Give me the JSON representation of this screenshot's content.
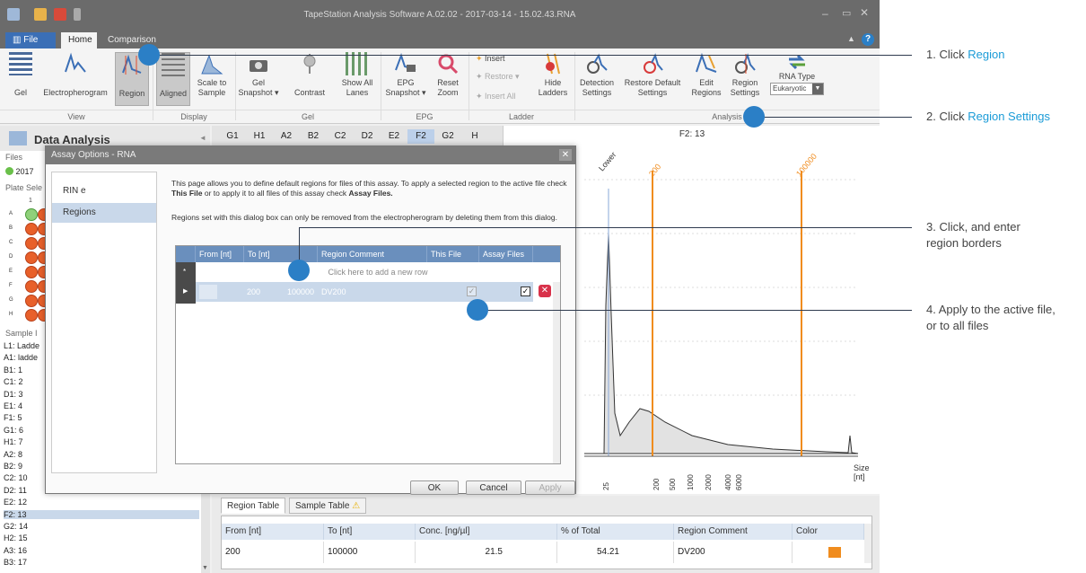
{
  "window": {
    "title": "TapeStation Analysis Software A.02.02 - 2017-03-14 - 15.02.43.RNA"
  },
  "tabs": {
    "file": "File",
    "home": "Home",
    "comparison": "Comparison"
  },
  "ribbon": {
    "gel": "Gel",
    "electropherogram": "Electropherogram",
    "region": "Region",
    "aligned": "Aligned",
    "scale_to_sample_1": "Scale to",
    "scale_to_sample_2": "Sample",
    "gel_snapshot_1": "Gel",
    "gel_snapshot_2": "Snapshot ▾",
    "contrast": "Contrast",
    "show_all_lanes_1": "Show All",
    "show_all_lanes_2": "Lanes",
    "epg_snapshot_1": "EPG",
    "epg_snapshot_2": "Snapshot ▾",
    "reset_zoom_1": "Reset",
    "reset_zoom_2": "Zoom",
    "insert": "Insert",
    "restore": "Restore ▾",
    "insert_all": "Insert All",
    "hide_ladders_1": "Hide",
    "hide_ladders_2": "Ladders",
    "detection_settings_1": "Detection",
    "detection_settings_2": "Settings",
    "restore_default_settings_1": "Restore Default",
    "restore_default_settings_2": "Settings",
    "edit_regions_1": "Edit",
    "edit_regions_2": "Regions",
    "region_settings_1": "Region",
    "region_settings_2": "Settings",
    "rna_type": "RNA Type",
    "rna_type_value": "Eukaryotic",
    "groups": {
      "view": "View",
      "display": "Display",
      "gel": "Gel",
      "epg": "EPG",
      "ladder": "Ladder",
      "analysis": "Analysis"
    }
  },
  "left_panel": {
    "title": "Data Analysis",
    "files_label": "Files",
    "file_item": "2017",
    "plate_label": "Plate Sele",
    "sample_label": "Sample I",
    "samples": [
      "L1: Ladde",
      "A1: ladde",
      "B1: 1",
      "C1: 2",
      "D1: 3",
      "E1: 4",
      "F1: 5",
      "G1: 6",
      "H1: 7",
      "A2: 8",
      "B2: 9",
      "C2: 10",
      "D2: 11",
      "E2: 12",
      "F2: 13",
      "G2: 14",
      "H2: 15",
      "A3: 16",
      "B3: 17"
    ],
    "row_letters": [
      "A",
      "B",
      "C",
      "D",
      "E",
      "F",
      "G",
      "H"
    ],
    "col_number": "1"
  },
  "lanes": [
    "G1",
    "H1",
    "A2",
    "B2",
    "C2",
    "D2",
    "E2",
    "F2",
    "G2",
    "H"
  ],
  "epg": {
    "title": "F2: 13",
    "markers": {
      "lower": "Lower",
      "m200": "200",
      "m100000": "100000"
    },
    "x_ticks": [
      "25",
      "200",
      "500",
      "1000",
      "2000",
      "4000",
      "6000"
    ],
    "size_label_1": "Size",
    "size_label_2": "[nt]"
  },
  "dialog": {
    "title": "Assay Options - RNA",
    "nav": [
      "RIN e",
      "Regions"
    ],
    "para1": "This page allows you to define default regions for files of this assay. To apply a selected region to the active file check",
    "para1_b1": "This File",
    "para1_mid": "or to apply it to all files of this assay check",
    "para1_b2": "Assay Files.",
    "para2": "Regions set with this dialog box can only be removed from the electropherogram by deleting them from this dialog.",
    "grid_headers": [
      "From [nt]",
      "To [nt]",
      "Region Comment",
      "This File",
      "Assay Files"
    ],
    "new_row_hint": "Click here to add a new row",
    "row": {
      "from": "200",
      "to": "100000",
      "comment": "DV200"
    },
    "ok": "OK",
    "cancel": "Cancel",
    "apply": "Apply"
  },
  "bottom": {
    "tabs": [
      "Region Table",
      "Sample Table"
    ],
    "headers": [
      "From [nt]",
      "To [nt]",
      "Conc. [ng/µl]",
      "% of Total",
      "Region Comment",
      "Color"
    ],
    "row": {
      "from": "200",
      "to": "100000",
      "conc": "21.5",
      "pct": "54.21",
      "comment": "DV200"
    },
    "color": "#f08c1e"
  },
  "annotations": {
    "a1_pre": "1. Click ",
    "a1_hl": "Region",
    "a2_pre": "2. Click ",
    "a2_hl": "Region Settings",
    "a3_1": "3. Click, and enter",
    "a3_2": "region borders",
    "a4_1": "4. Apply to the active file,",
    "a4_2": "or to all files"
  }
}
